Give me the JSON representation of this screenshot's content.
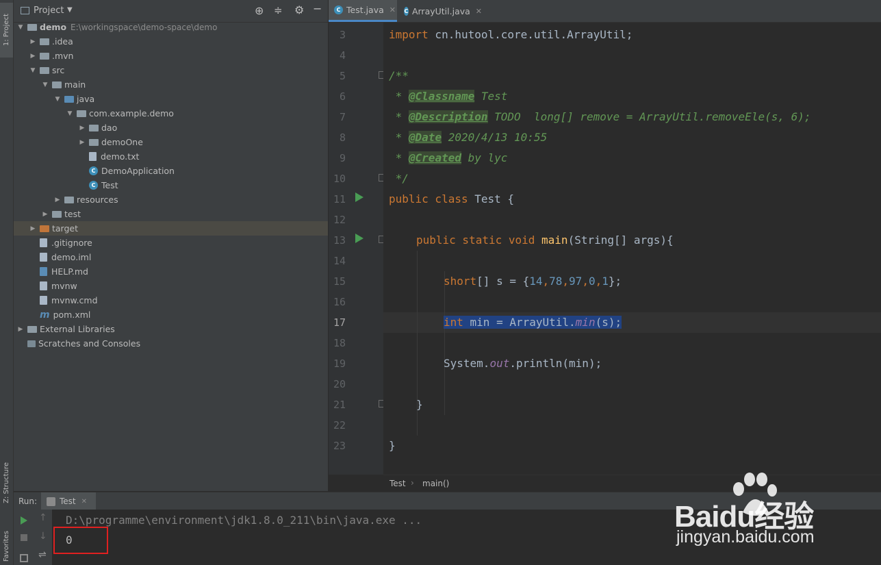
{
  "left_strip": {
    "project_tab": "1: Project",
    "structure_tab": "Z: Structure",
    "favorites_tab": "Favorites"
  },
  "project_panel": {
    "title": "Project",
    "tree": [
      {
        "label": "demo",
        "path": "E:\\workingspace\\demo-space\\demo",
        "indent": 0,
        "arrow": "down",
        "icon": "module-folder"
      },
      {
        "label": ".idea",
        "indent": 1,
        "arrow": "right",
        "icon": "folder"
      },
      {
        "label": ".mvn",
        "indent": 1,
        "arrow": "right",
        "icon": "folder"
      },
      {
        "label": "src",
        "indent": 1,
        "arrow": "down",
        "icon": "folder"
      },
      {
        "label": "main",
        "indent": 2,
        "arrow": "down",
        "icon": "folder"
      },
      {
        "label": "java",
        "indent": 3,
        "arrow": "down",
        "icon": "source-folder"
      },
      {
        "label": "com.example.demo",
        "indent": 4,
        "arrow": "down",
        "icon": "package"
      },
      {
        "label": "dao",
        "indent": 5,
        "arrow": "right",
        "icon": "package"
      },
      {
        "label": "demoOne",
        "indent": 5,
        "arrow": "right",
        "icon": "package"
      },
      {
        "label": "demo.txt",
        "indent": 5,
        "arrow": "none",
        "icon": "file"
      },
      {
        "label": "DemoApplication",
        "indent": 5,
        "arrow": "none",
        "icon": "class"
      },
      {
        "label": "Test",
        "indent": 5,
        "arrow": "none",
        "icon": "class"
      },
      {
        "label": "resources",
        "indent": 3,
        "arrow": "right",
        "icon": "resources-folder"
      },
      {
        "label": "test",
        "indent": 2,
        "arrow": "right",
        "icon": "folder"
      },
      {
        "label": "target",
        "indent": 1,
        "arrow": "right",
        "icon": "excluded-folder",
        "selected": true
      },
      {
        "label": ".gitignore",
        "indent": 1,
        "arrow": "none",
        "icon": "file"
      },
      {
        "label": "demo.iml",
        "indent": 1,
        "arrow": "none",
        "icon": "file"
      },
      {
        "label": "HELP.md",
        "indent": 1,
        "arrow": "none",
        "icon": "markdown"
      },
      {
        "label": "mvnw",
        "indent": 1,
        "arrow": "none",
        "icon": "file"
      },
      {
        "label": "mvnw.cmd",
        "indent": 1,
        "arrow": "none",
        "icon": "file"
      },
      {
        "label": "pom.xml",
        "indent": 1,
        "arrow": "none",
        "icon": "maven"
      },
      {
        "label": "External Libraries",
        "indent": 0,
        "arrow": "right",
        "icon": "libraries"
      },
      {
        "label": "Scratches and Consoles",
        "indent": 0,
        "arrow": "none",
        "icon": "scratches"
      }
    ]
  },
  "editor": {
    "tabs": [
      {
        "label": "Test.java",
        "active": true
      },
      {
        "label": "ArrayUtil.java",
        "active": false
      }
    ],
    "line_numbers": [
      "3",
      "4",
      "5",
      "6",
      "7",
      "8",
      "9",
      "10",
      "11",
      "12",
      "13",
      "14",
      "15",
      "16",
      "17",
      "18",
      "19",
      "20",
      "21",
      "22",
      "23"
    ],
    "current_line": "17",
    "code": {
      "l3_kw": "import",
      "l3_rest": " cn.hutool.core.util.ArrayUtil;",
      "l5": "/**",
      "l6_star": " * ",
      "l6_tag": "@Classname",
      "l6_rest": " Test",
      "l7_star": " * ",
      "l7_tag": "@Description",
      "l7_rest": " TODO  long[] remove = ArrayUtil.removeEle(s, 6);",
      "l8_star": " * ",
      "l8_tag": "@Date",
      "l8_rest": " 2020/4/13 10:55",
      "l9_star": " * ",
      "l9_tag": "@Created",
      "l9_rest": " by lyc",
      "l10": " */",
      "l11_kw": "public class",
      "l11_rest": " Test {",
      "l13_kw": "public static void",
      "l13_fn": " main",
      "l13_rest": "(String[] args){",
      "l15_kw": "short",
      "l15_a": "[] s = {",
      "l15_n1": "14",
      "l15_c1": ",",
      "l15_n2": "78",
      "l15_c2": ",",
      "l15_n3": "97",
      "l15_c3": ",",
      "l15_n4": "0",
      "l15_c4": ",",
      "l15_n5": "1",
      "l15_b": "};",
      "l17_kw": "int",
      "l17_a": " min = ArrayUtil.",
      "l17_static": "min",
      "l17_b": "(s);",
      "l19_a": "System.",
      "l19_static": "out",
      "l19_b": ".println(min);",
      "l21": "}",
      "l23": "}"
    },
    "breadcrumb": [
      "Test",
      "main()"
    ]
  },
  "run_panel": {
    "label": "Run:",
    "tab": "Test",
    "console_command": "D:\\programme\\environment\\jdk1.8.0_211\\bin\\java.exe ...",
    "console_output": "0"
  },
  "watermark": {
    "logo_text": "Baidu经验",
    "url": "jingyan.baidu.com"
  },
  "colors": {
    "accent": "#4a88c7",
    "highlight_box": "#e02020",
    "selection": "#214283"
  }
}
